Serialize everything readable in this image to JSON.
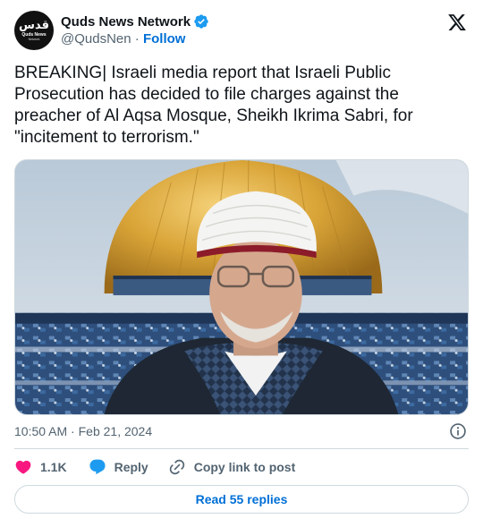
{
  "author": {
    "display_name": "Quds News Network",
    "handle": "@QudsNen",
    "separator": "·",
    "follow_label": "Follow",
    "avatar_logo": "قدس",
    "avatar_logo_sub": "Quds News",
    "avatar_logo_sub2": "Network",
    "verified_icon": "verified-badge-icon",
    "verified_color": "#1d9bf0"
  },
  "platform_icon": "x-logo-icon",
  "tweet": {
    "text": "BREAKING| Israeli media report that Israeli Public Prosecution has decided to file charges against the preacher of Al Aqsa Mosque, Sheikh Ikrima Sabri, for \"incitement to terrorism.\"",
    "media_icon": "photo-dome-of-the-rock-sheikh"
  },
  "meta": {
    "time": "10:50 AM",
    "separator": "·",
    "date": "Feb 21, 2024",
    "info_icon": "info-icon"
  },
  "actions": {
    "like_count": "1.1K",
    "like_color": "#f91880",
    "reply_label": "Reply",
    "reply_color": "#1d9bf0",
    "copy_label": "Copy link to post"
  },
  "read_replies_label": "Read 55 replies",
  "colors": {
    "link_blue": "#006fd6",
    "text_primary": "#0f1419",
    "text_secondary": "#536471",
    "border": "#cfd9de"
  }
}
